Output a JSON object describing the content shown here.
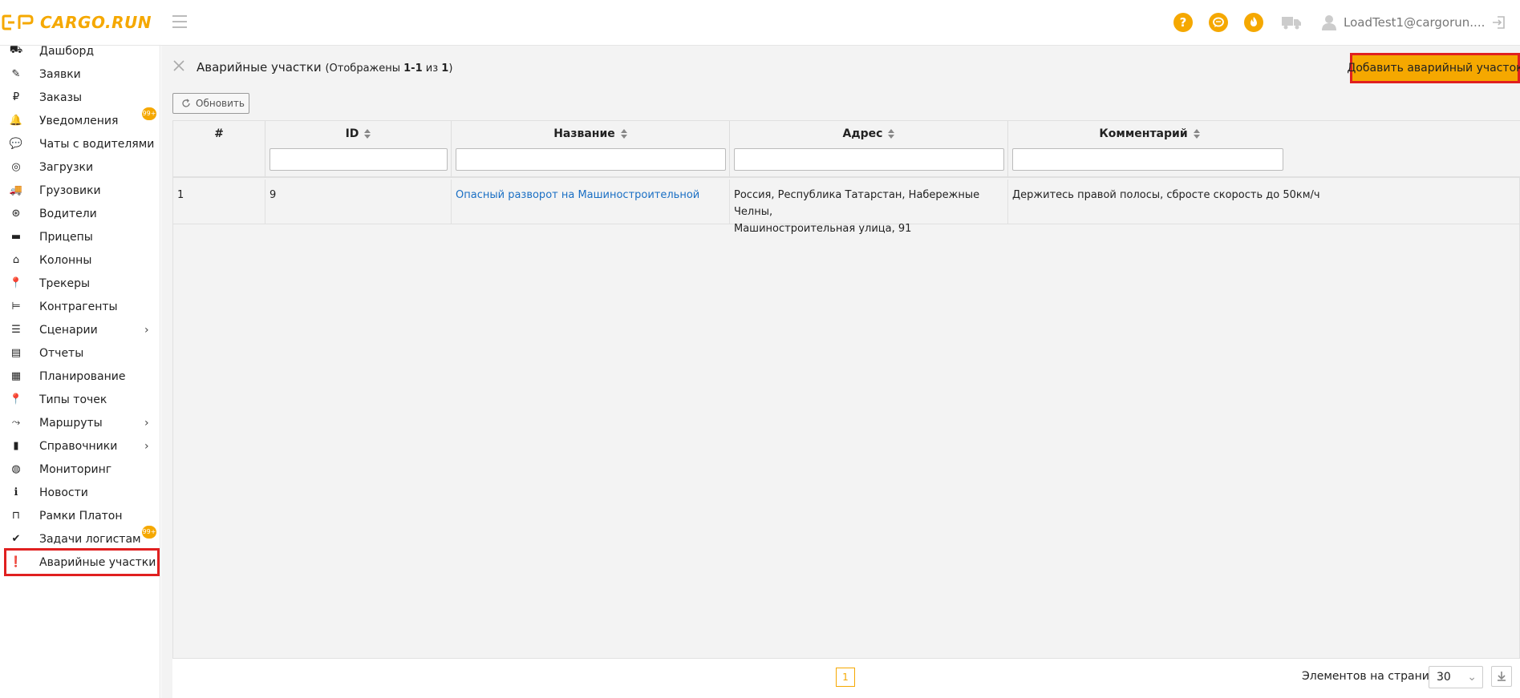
{
  "app": {
    "logo_text": "CARGO.RUN",
    "user_name": "LoadTest1@cargorun....",
    "brand_color": "#f5a800",
    "header_icons": [
      "help-icon",
      "chat-icon",
      "fire-icon",
      "truck-icon",
      "user-icon",
      "logout-icon"
    ]
  },
  "header": {
    "help_symbol": "?",
    "chat_symbol": "…",
    "fire_symbol": "♨"
  },
  "sidebar": {
    "items": [
      {
        "label": "Дашборд",
        "icon": "dashboard-icon"
      },
      {
        "label": "Заявки",
        "icon": "edit-icon"
      },
      {
        "label": "Заказы",
        "icon": "ruble-icon"
      },
      {
        "label": "Уведомления",
        "icon": "bell-icon",
        "badge": "99+"
      },
      {
        "label": "Чаты с водителями",
        "icon": "chat-icon"
      },
      {
        "label": "Загрузки",
        "icon": "compass-icon"
      },
      {
        "label": "Грузовики",
        "icon": "truck-icon"
      },
      {
        "label": "Водители",
        "icon": "steering-wheel-icon"
      },
      {
        "label": "Прицепы",
        "icon": "trailer-icon"
      },
      {
        "label": "Колонны",
        "icon": "warehouse-icon"
      },
      {
        "label": "Трекеры",
        "icon": "map-pin-icon"
      },
      {
        "label": "Контрагенты",
        "icon": "dolly-icon"
      },
      {
        "label": "Сценарии",
        "icon": "list-icon",
        "has_submenu": true
      },
      {
        "label": "Отчеты",
        "icon": "report-icon"
      },
      {
        "label": "Планирование",
        "icon": "calendar-icon"
      },
      {
        "label": "Типы точек",
        "icon": "map-pin-icon"
      },
      {
        "label": "Маршруты",
        "icon": "route-icon",
        "has_submenu": true
      },
      {
        "label": "Справочники",
        "icon": "book-icon",
        "has_submenu": true
      },
      {
        "label": "Мониторинг",
        "icon": "globe-icon"
      },
      {
        "label": "Новости",
        "icon": "info-icon"
      },
      {
        "label": "Рамки Платон",
        "icon": "gate-icon"
      },
      {
        "label": "Задачи логистам",
        "icon": "check-icon",
        "badge": "99+"
      },
      {
        "label": "Аварийные участки",
        "icon": "exclamation-icon",
        "active": true
      }
    ]
  },
  "main": {
    "title": "Аварийные участки",
    "subtitle_prefix": "(Отображены ",
    "subtitle_range": "1-1",
    "subtitle_mid": " из ",
    "subtitle_total": "1",
    "subtitle_suffix": ")",
    "add_button": "Добавить аварийный участок",
    "refresh_button": "Обновить"
  },
  "table": {
    "columns": [
      "#",
      "ID",
      "Название",
      "Адрес",
      "Комментарий"
    ],
    "rows": [
      {
        "num": "1",
        "id": "9",
        "name": "Опасный разворот на Машиностроительной",
        "address_line1": "Россия, Республика Татарстан, Набережные Челны,",
        "address_line2": "Машиностроительная улица, 91",
        "comment": "Держитесь правой полосы, сбросте скорость до 50км/ч"
      }
    ]
  },
  "footer": {
    "current_page": "1",
    "per_page_label": "Элементов на странице",
    "per_page_value": "30"
  }
}
